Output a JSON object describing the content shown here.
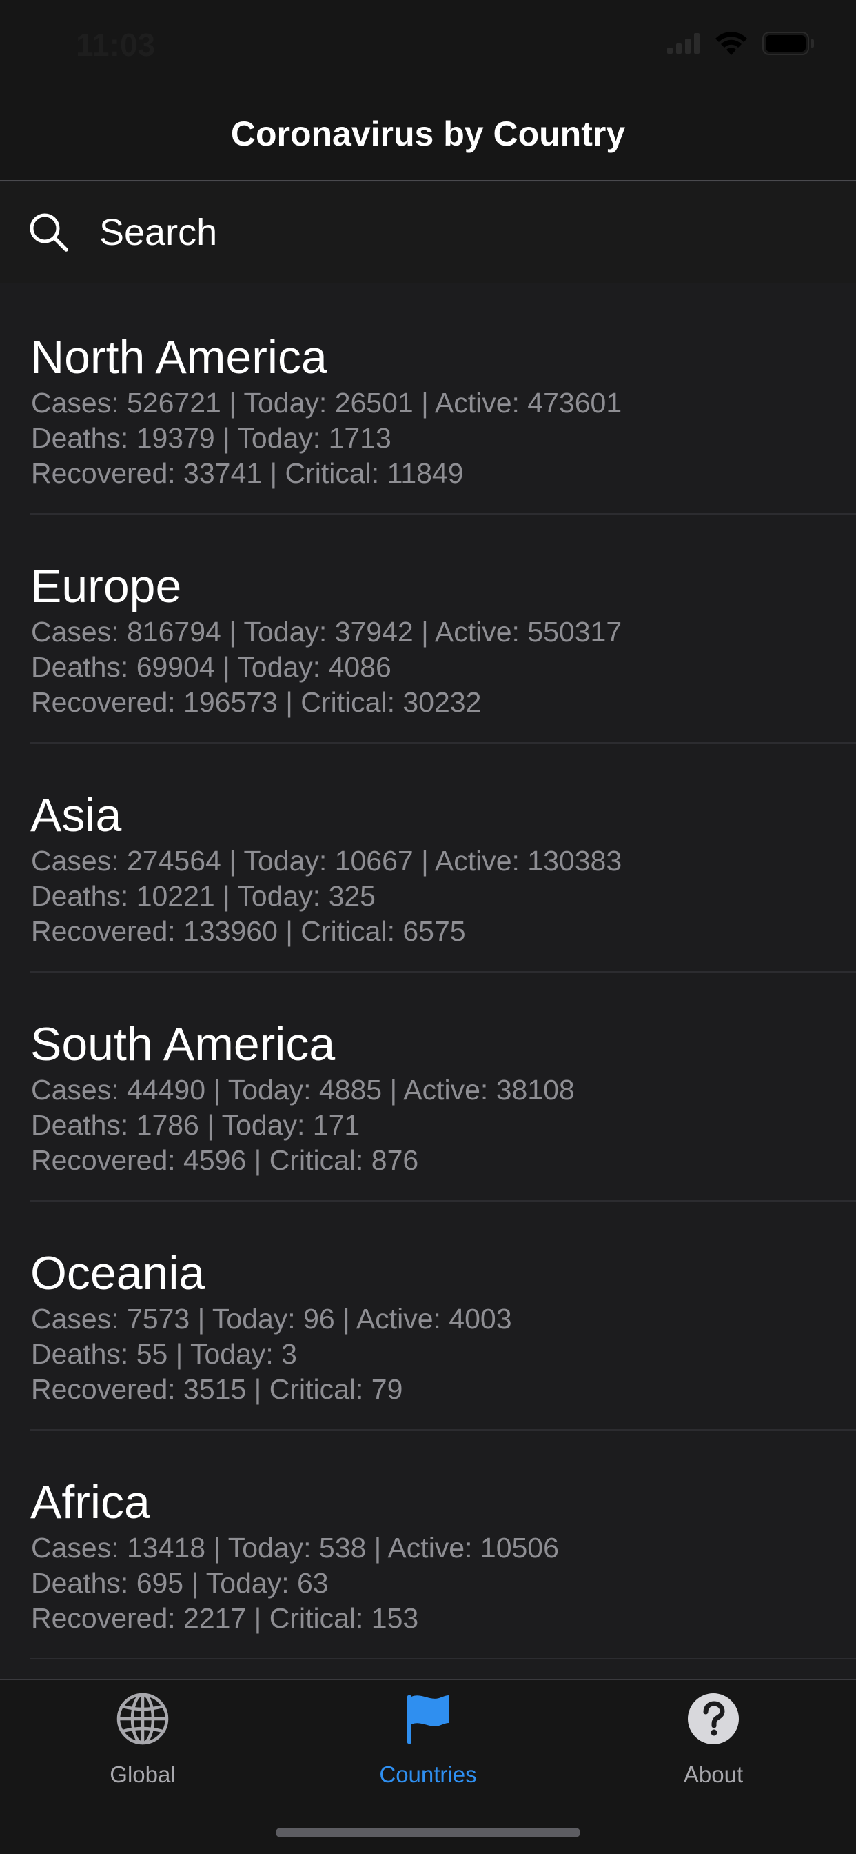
{
  "status_bar": {
    "time": "11:03"
  },
  "nav": {
    "title": "Coronavirus by Country"
  },
  "search": {
    "placeholder": "Search",
    "icon": "search-icon"
  },
  "regions": [
    {
      "name": "North America",
      "line1": "Cases: 526721 | Today: 26501 | Active: 473601",
      "line2": "Deaths: 19379 | Today: 1713",
      "line3": "Recovered: 33741 | Critical: 11849"
    },
    {
      "name": "Europe",
      "line1": "Cases: 816794 | Today: 37942 | Active: 550317",
      "line2": "Deaths: 69904 | Today: 4086",
      "line3": "Recovered: 196573 | Critical: 30232"
    },
    {
      "name": "Asia",
      "line1": "Cases: 274564 | Today: 10667 | Active: 130383",
      "line2": "Deaths: 10221 | Today: 325",
      "line3": "Recovered: 133960 | Critical: 6575"
    },
    {
      "name": "South America",
      "line1": "Cases: 44490 | Today: 4885 | Active: 38108",
      "line2": "Deaths: 1786 | Today: 171",
      "line3": "Recovered: 4596 | Critical: 876"
    },
    {
      "name": "Oceania",
      "line1": "Cases: 7573 | Today: 96 | Active: 4003",
      "line2": "Deaths: 55 | Today: 3",
      "line3": "Recovered: 3515 | Critical: 79"
    },
    {
      "name": "Africa",
      "line1": "Cases: 13418 | Today: 538 | Active: 10506",
      "line2": "Deaths: 695 | Today: 63",
      "line3": "Recovered: 2217 | Critical: 153"
    }
  ],
  "tabs": [
    {
      "label": "Global",
      "icon": "globe-icon",
      "active": false
    },
    {
      "label": "Countries",
      "icon": "flag-icon",
      "active": true
    },
    {
      "label": "About",
      "icon": "question-circle-icon",
      "active": false
    }
  ],
  "colors": {
    "background": "#1c1c1e",
    "bar_background": "#161616",
    "primary_text": "#ffffff",
    "secondary_text": "#8e8e93",
    "accent": "#2f8ff0",
    "inactive_tab": "#a8a8ad"
  }
}
